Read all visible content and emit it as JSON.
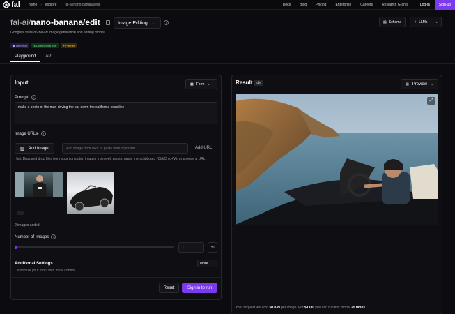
{
  "topbar": {
    "logo": "fal",
    "crumbs": [
      "home",
      "explore",
      "fal-ai/nano-banana/edit"
    ],
    "nav": [
      "Docs",
      "Blog",
      "Pricing",
      "Enterprise",
      "Careers",
      "Research Grants"
    ],
    "login": "Log-in",
    "signup": "Sign-up"
  },
  "header": {
    "org": "fal-ai/",
    "model": "nano-banana/edit",
    "mode_select": "Image Editing",
    "subtitle": "Google's state-of-the-art image generation and editing model",
    "badges": [
      "Inference",
      "Commercial use",
      "Partner"
    ],
    "schema_btn": "Schema",
    "llms_btn": "LLMs"
  },
  "tabs": [
    "Playground",
    "API"
  ],
  "input": {
    "title": "Input",
    "form_btn": "Form",
    "prompt_label": "Prompt",
    "required_mark": "*",
    "prompt_value": "make a photo of the man driving the car down the california coastline",
    "urls_label": "Image URLs",
    "add_image": "Add Image",
    "url_placeholder": "Add image from URL or paste from clipboard",
    "add_url": "Add URL",
    "hint": "Hint: Drag and drop files from your computer, images from web pages, paste from clipboard (Ctrl/Cmd+V), or provide a URL.",
    "images_added": "2 images added",
    "num_images_label": "Number of Images",
    "num_images_value": "1",
    "additional_title": "Additional Settings",
    "additional_sub": "Customize your input with more control.",
    "more_btn": "More",
    "reset_btn": "Reset",
    "run_btn": "Sign in to run"
  },
  "result": {
    "title": "Result",
    "status": "Idle",
    "preview_btn": "Preview",
    "footer_pre": "Your request will cost ",
    "cost": "$0.039",
    "footer_mid": " per image. For ",
    "budget": "$1.00",
    "footer_mid2": ", you can run this model ",
    "runs": "25 times",
    "footer_end": "."
  },
  "colors": {
    "accent": "#7b3aed",
    "bg": "#0c0c10",
    "panel": "#0f0f13"
  }
}
